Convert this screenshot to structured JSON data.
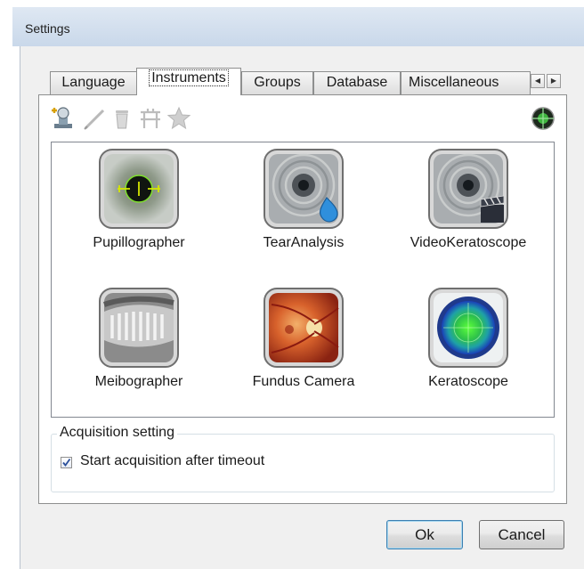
{
  "window": {
    "title": "Settings"
  },
  "tabs": [
    {
      "label": "Language",
      "active": false
    },
    {
      "label": "Instruments",
      "active": true
    },
    {
      "label": "Groups",
      "active": false
    },
    {
      "label": "Database",
      "active": false
    },
    {
      "label": "Miscellaneous",
      "active": false
    }
  ],
  "tab_scroll": {
    "left_icon": "triangle-left-icon",
    "right_icon": "triangle-right-icon"
  },
  "toolbar": {
    "icons": [
      "add-instrument-icon",
      "edit-pencil-icon",
      "delete-trash-icon",
      "device-config-icon",
      "favorite-star-icon"
    ],
    "status_icon": "crosshair-status-icon"
  },
  "instruments": [
    {
      "label": "Pupillographer",
      "icon": "pupil-eye-icon"
    },
    {
      "label": "TearAnalysis",
      "icon": "tear-rings-icon"
    },
    {
      "label": "VideoKeratoscope",
      "icon": "video-rings-icon"
    },
    {
      "label": "Meibographer",
      "icon": "eyelid-gland-icon"
    },
    {
      "label": "Fundus Camera",
      "icon": "retina-fundus-icon"
    },
    {
      "label": "Keratoscope",
      "icon": "cornea-map-icon"
    }
  ],
  "acquisition": {
    "group_title": "Acquisition setting",
    "checkbox_label": "Start acquisition after timeout",
    "checked": true
  },
  "buttons": {
    "ok": "Ok",
    "cancel": "Cancel"
  },
  "colors": {
    "accent": "#3c7fb1",
    "titlebar": "#c9d8ea",
    "window_bg": "#f0f0f0"
  }
}
